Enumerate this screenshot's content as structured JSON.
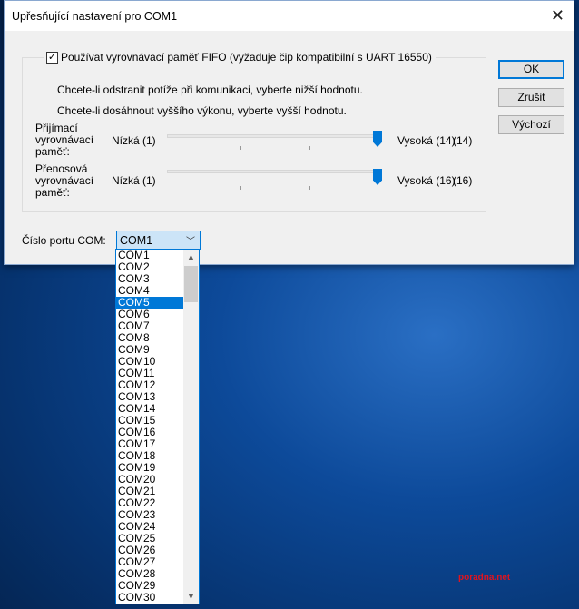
{
  "dialog": {
    "title": "Upřesňující nastavení pro COM1",
    "fifo_label": "Používat vyrovnávací paměť FIFO (vyžaduje čip kompatibilní s UART 16550)",
    "hint_low": "Chcete-li odstranit potíže při komunikaci, vyberte nižší hodnotu.",
    "hint_high": "Chcete-li dosáhnout vyššího výkonu, vyberte vyšší hodnotu.",
    "receive": {
      "label": "Přijímací vyrovnávací paměť:",
      "low": "Nízká (1)",
      "high": "Vysoká (14)",
      "value_text": "(14)",
      "value": 14,
      "max": 14
    },
    "transmit": {
      "label": "Přenosová vyrovnávací paměť:",
      "low": "Nízká (1)",
      "high": "Vysoká (16)",
      "value_text": "(16)",
      "value": 16,
      "max": 16
    },
    "ok": "OK",
    "cancel": "Zrušit",
    "default": "Výchozí",
    "port_label": "Číslo portu COM:",
    "port_value": "COM1",
    "ports": [
      "COM1",
      "COM2",
      "COM3",
      "COM4",
      "COM5",
      "COM6",
      "COM7",
      "COM8",
      "COM9",
      "COM10",
      "COM11",
      "COM12",
      "COM13",
      "COM14",
      "COM15",
      "COM16",
      "COM17",
      "COM18",
      "COM19",
      "COM20",
      "COM21",
      "COM22",
      "COM23",
      "COM24",
      "COM25",
      "COM26",
      "COM27",
      "COM28",
      "COM29",
      "COM30"
    ],
    "selected_index": 4
  },
  "watermark": "poradna.net"
}
